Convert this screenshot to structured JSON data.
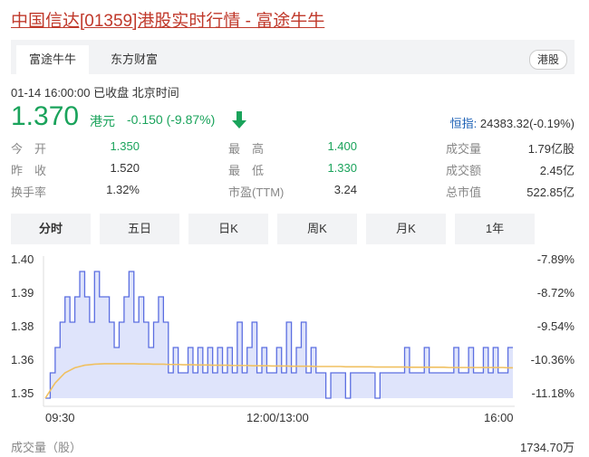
{
  "title": "中国信达[01359]港股实时行情 - 富途牛牛",
  "tabs": [
    {
      "label": "富途牛牛",
      "active": true
    },
    {
      "label": "东方财富",
      "active": false
    }
  ],
  "market_badge": "港股",
  "status": "01-14 16:00:00  已收盘  北京时间",
  "price": "1.370",
  "currency": "港元",
  "change": "-0.150 (-9.87%)",
  "change_direction_icon": "arrow-down-icon",
  "index": {
    "label": "恒指:",
    "value": "24383.32(-0.19%)"
  },
  "quote": {
    "open": {
      "label": "今　开",
      "value": "1.350"
    },
    "prev_close": {
      "label": "昨　收",
      "value": "1.520"
    },
    "turnover_rate": {
      "label": "换手率",
      "value": "1.32%"
    },
    "high": {
      "label": "最　高",
      "value": "1.400"
    },
    "low": {
      "label": "最　低",
      "value": "1.330"
    },
    "pe": {
      "label": "市盈(TTM)",
      "value": "3.24"
    },
    "volume": {
      "label": "成交量",
      "value": "1.79亿股"
    },
    "amount": {
      "label": "成交额",
      "value": "2.45亿"
    },
    "market_cap": {
      "label": "总市值",
      "value": "522.85亿"
    }
  },
  "period_tabs": [
    "分时",
    "五日",
    "日K",
    "周K",
    "月K",
    "1年"
  ],
  "active_period": "分时",
  "chart_data": {
    "type": "line",
    "y_ticks": [
      "1.40",
      "1.39",
      "1.38",
      "1.36",
      "1.35"
    ],
    "y_right_ticks": [
      "-7.89%",
      "-8.72%",
      "-9.54%",
      "-10.36%",
      "-11.18%"
    ],
    "x_ticks": [
      "09:30",
      "12:00/13:00",
      "16:00"
    ],
    "ylim": [
      1.35,
      1.4
    ],
    "series": [
      {
        "color": "#5b6ee1",
        "values": [
          1.35,
          1.36,
          1.37,
          1.38,
          1.39,
          1.38,
          1.39,
          1.4,
          1.39,
          1.38,
          1.4,
          1.39,
          1.39,
          1.38,
          1.37,
          1.38,
          1.39,
          1.4,
          1.38,
          1.39,
          1.38,
          1.37,
          1.38,
          1.39,
          1.38,
          1.36,
          1.37,
          1.36,
          1.36,
          1.37,
          1.36,
          1.37,
          1.36,
          1.37,
          1.36,
          1.37,
          1.36,
          1.37,
          1.36,
          1.38,
          1.36,
          1.37,
          1.38,
          1.36,
          1.37,
          1.36,
          1.36,
          1.37,
          1.36,
          1.38,
          1.36,
          1.37,
          1.38,
          1.36,
          1.37,
          1.36,
          1.36,
          1.35,
          1.36,
          1.36,
          1.36,
          1.35,
          1.36,
          1.36,
          1.36,
          1.36,
          1.36,
          1.35,
          1.36,
          1.36,
          1.36,
          1.36,
          1.36,
          1.37,
          1.36,
          1.36,
          1.36,
          1.37,
          1.36,
          1.36,
          1.36,
          1.36,
          1.36,
          1.37,
          1.36,
          1.36,
          1.37,
          1.36,
          1.36,
          1.37,
          1.36,
          1.37,
          1.36,
          1.36,
          1.37,
          1.37
        ]
      },
      {
        "color": "#f0c060",
        "values": [
          1.35,
          1.353,
          1.356,
          1.358,
          1.36,
          1.361,
          1.362,
          1.3625,
          1.363,
          1.3632,
          1.3634,
          1.3635,
          1.3636,
          1.3636,
          1.3636,
          1.3636,
          1.3636,
          1.3636,
          1.3636,
          1.3635,
          1.3635,
          1.3635,
          1.3634,
          1.3634,
          1.3634,
          1.3633,
          1.3633,
          1.3633,
          1.3632,
          1.3632,
          1.3632,
          1.3631,
          1.3631,
          1.3631,
          1.363,
          1.363,
          1.363,
          1.363,
          1.3629,
          1.3629,
          1.3629,
          1.3629,
          1.3628,
          1.3628,
          1.3628,
          1.3628,
          1.3627,
          1.3627,
          1.3627,
          1.3627,
          1.3626,
          1.3626,
          1.3626,
          1.3626,
          1.3626,
          1.3625,
          1.3625,
          1.3625,
          1.3625,
          1.3625,
          1.3625,
          1.3624,
          1.3624,
          1.3624,
          1.3624,
          1.3624,
          1.3624,
          1.3623,
          1.3623,
          1.3623,
          1.3623,
          1.3623,
          1.3623,
          1.3623,
          1.3622,
          1.3622,
          1.3622,
          1.3622,
          1.3622,
          1.3622,
          1.3622,
          1.3622,
          1.3621,
          1.3621,
          1.3621,
          1.3621,
          1.3621,
          1.3621,
          1.3621,
          1.3621,
          1.3621,
          1.3621,
          1.3621,
          1.3621,
          1.362,
          1.362
        ]
      }
    ]
  },
  "volume_label": "成交量（股）",
  "volume_value": "1734.70万"
}
